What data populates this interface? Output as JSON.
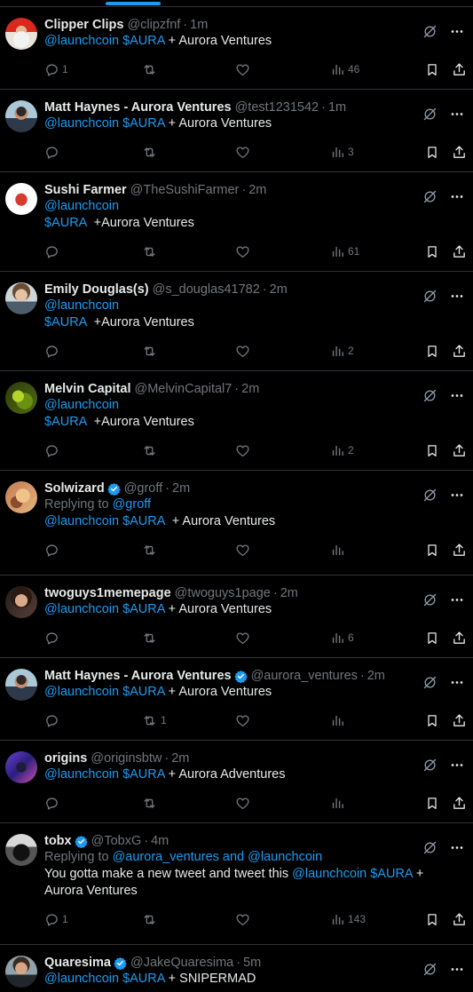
{
  "colors": {
    "background": "#000000",
    "text": "#e7e9ea",
    "muted": "#71767b",
    "link": "#1d9bf0",
    "divider": "#2f3336"
  },
  "icons": {
    "grok": "grok-icon",
    "more": "more-icon",
    "reply": "reply-icon",
    "retweet": "retweet-icon",
    "like": "like-icon",
    "views": "views-icon",
    "bookmark": "bookmark-icon",
    "share": "share-icon",
    "verified": "verified-icon"
  },
  "tweets": [
    {
      "name": "Clipper Clips",
      "handle": "@clipzfnf",
      "sep": "·",
      "time": "1m",
      "lines": [
        [
          "@launchcoin $AURA",
          " + Aurora Ventures"
        ]
      ],
      "replies": "1",
      "retweets": "",
      "likes": "",
      "views": "46"
    },
    {
      "name": "Matt Haynes - Aurora Ventures",
      "handle": "@test1231542",
      "sep": "·",
      "time": "1m",
      "lines": [
        [
          "@launchcoin $AURA",
          " + Aurora Ventures"
        ]
      ],
      "replies": "",
      "retweets": "",
      "likes": "",
      "views": "3"
    },
    {
      "name": "Sushi Farmer",
      "handle": "@TheSushiFarmer",
      "sep": "·",
      "time": "2m",
      "lines": [
        [
          "@launchcoin",
          ""
        ],
        [
          "$AURA",
          "  +Aurora Ventures"
        ]
      ],
      "replies": "",
      "retweets": "",
      "likes": "",
      "views": "61"
    },
    {
      "name": "Emily Douglas(s)",
      "handle": "@s_douglas41782",
      "sep": "·",
      "time": "2m",
      "lines": [
        [
          "@launchcoin",
          ""
        ],
        [
          "$AURA",
          "  +Aurora Ventures"
        ]
      ],
      "replies": "",
      "retweets": "",
      "likes": "",
      "views": "2"
    },
    {
      "name": "Melvin Capital",
      "handle": "@MelvinCapital7",
      "sep": "·",
      "time": "2m",
      "lines": [
        [
          "@launchcoin",
          ""
        ],
        [
          "$AURA",
          "  +Aurora Ventures"
        ]
      ],
      "replies": "",
      "retweets": "",
      "likes": "",
      "views": "2"
    },
    {
      "name": "Solwizard",
      "handle": "@groff",
      "sep": "·",
      "time": "2m",
      "replying_prefix": "Replying to ",
      "replying_to": "@groff",
      "lines": [
        [
          "@launchcoin $AURA",
          "  + Aurora Ventures"
        ]
      ],
      "replies": "",
      "retweets": "",
      "likes": "",
      "views": ""
    },
    {
      "name": "twoguys1memepage",
      "handle": "@twoguys1page",
      "sep": "·",
      "time": "2m",
      "lines": [
        [
          "@launchcoin $AURA",
          " + Aurora Ventures"
        ]
      ],
      "replies": "",
      "retweets": "",
      "likes": "",
      "views": "6"
    },
    {
      "name": "Matt Haynes - Aurora Ventures",
      "handle": "@aurora_ventures",
      "sep": "·",
      "time": "2m",
      "lines": [
        [
          "@launchcoin $AURA",
          " + Aurora Ventures"
        ]
      ],
      "replies": "",
      "retweets": "1",
      "likes": "",
      "views": ""
    },
    {
      "name": "origins",
      "handle": "@originsbtw",
      "sep": "·",
      "time": "2m",
      "lines": [
        [
          "@launchcoin $AURA",
          " + Aurora Adventures"
        ]
      ],
      "replies": "",
      "retweets": "",
      "likes": "",
      "views": ""
    },
    {
      "name": "tobx",
      "handle": "@TobxG",
      "sep": "·",
      "time": "4m",
      "replying_prefix": "Replying to ",
      "replying_to": "@aurora_ventures and @launchcoin",
      "lines": [
        [
          "",
          "You gotta make a new tweet and tweet this ",
          "@launchcoin $AURA",
          " +"
        ],
        [
          "",
          "Aurora Ventures"
        ]
      ],
      "replies": "1",
      "retweets": "",
      "likes": "",
      "views": "143"
    },
    {
      "name": "Quaresima",
      "handle": "@JakeQuaresima",
      "sep": "·",
      "time": "5m",
      "lines": [
        [
          "@launchcoin $AURA",
          " + SNIPERMAD"
        ]
      ],
      "replies": "",
      "retweets": "",
      "likes": "",
      "views": ""
    }
  ]
}
